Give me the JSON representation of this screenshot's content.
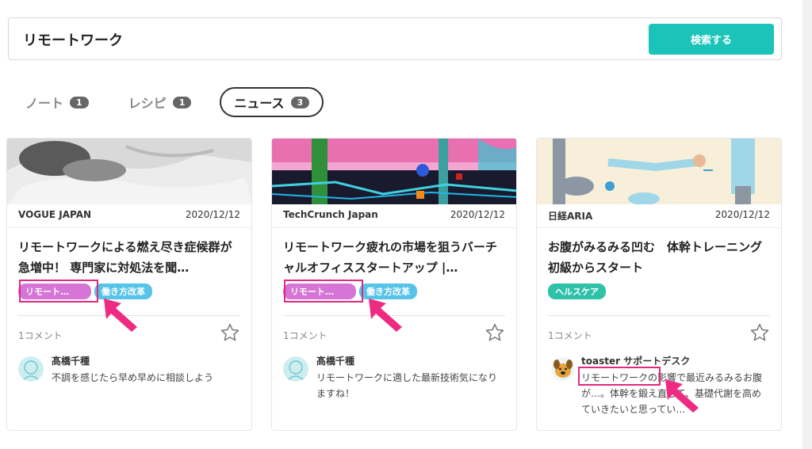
{
  "search": {
    "query": "リモートワーク",
    "button_label": "検索する"
  },
  "tabs": [
    {
      "label": "ノート",
      "count": "1",
      "active": false
    },
    {
      "label": "レシピ",
      "count": "1",
      "active": false
    },
    {
      "label": "ニュース",
      "count": "3",
      "active": true
    }
  ],
  "cards": [
    {
      "source": "VOGUE JAPAN",
      "date": "2020/12/12",
      "title": "リモートワークによる燃え尽き症候群が急増中！ 専門家に対処法を聞…",
      "tags": [
        "リモート…",
        "働き方改革"
      ],
      "comment_count": "1コメント",
      "commenter": "髙橋千種",
      "comment": "不調を感じたら早め早めに相談しよう"
    },
    {
      "source": "TechCrunch Japan",
      "date": "2020/12/12",
      "title": "リモートワーク疲れの市場を狙うバーチャルオフィススタートアップ |…",
      "tags": [
        "リモート…",
        "働き方改革"
      ],
      "comment_count": "1コメント",
      "commenter": "髙橋千種",
      "comment": "リモートワークに適した最新技術気になりますね！"
    },
    {
      "source": "日経ARIA",
      "date": "2020/12/12",
      "title": "お腹がみるみる凹む　体幹トレーニング初級からスタート",
      "tags": [
        "ヘルスケア"
      ],
      "comment_count": "1コメント",
      "commenter": "toaster サポートデスク",
      "comment_highlight": "リモートワーク",
      "comment": "の影響で最近みるみるお腹が…。体幹を鍛え直して、基礎代謝を高めていきたいと思ってい…"
    }
  ],
  "colors": {
    "accent": "#1cc3b8",
    "tag_pink": "#d675d6",
    "tag_blue": "#56c3e9",
    "tag_teal": "#2fc2a9",
    "highlight": "#e2287f"
  }
}
